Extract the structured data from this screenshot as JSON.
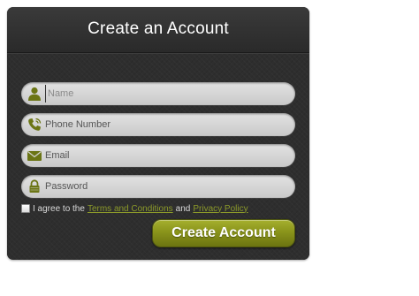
{
  "form": {
    "title": "Create an Account",
    "fields": [
      {
        "icon": "user-icon",
        "value": "",
        "placeholder": "Name"
      },
      {
        "icon": "phone-icon",
        "value": "",
        "placeholder": "Phone Number"
      },
      {
        "icon": "mail-icon",
        "value": "",
        "placeholder": "Email"
      },
      {
        "icon": "lock-icon",
        "value": "",
        "placeholder": "Password"
      }
    ],
    "terms": {
      "checked": false,
      "prefix": "I agree to the",
      "terms_link": "Terms and Conditions",
      "conjunction": "and",
      "privacy_link": "Privacy Policy"
    },
    "submit_label": "Create Account"
  },
  "colors": {
    "card_background": "#2b2b2b",
    "field_background": "#d5d5d5",
    "icon_color": "#6b7514",
    "link_color": "#8c9a2a",
    "button_color": "#8a941b"
  }
}
